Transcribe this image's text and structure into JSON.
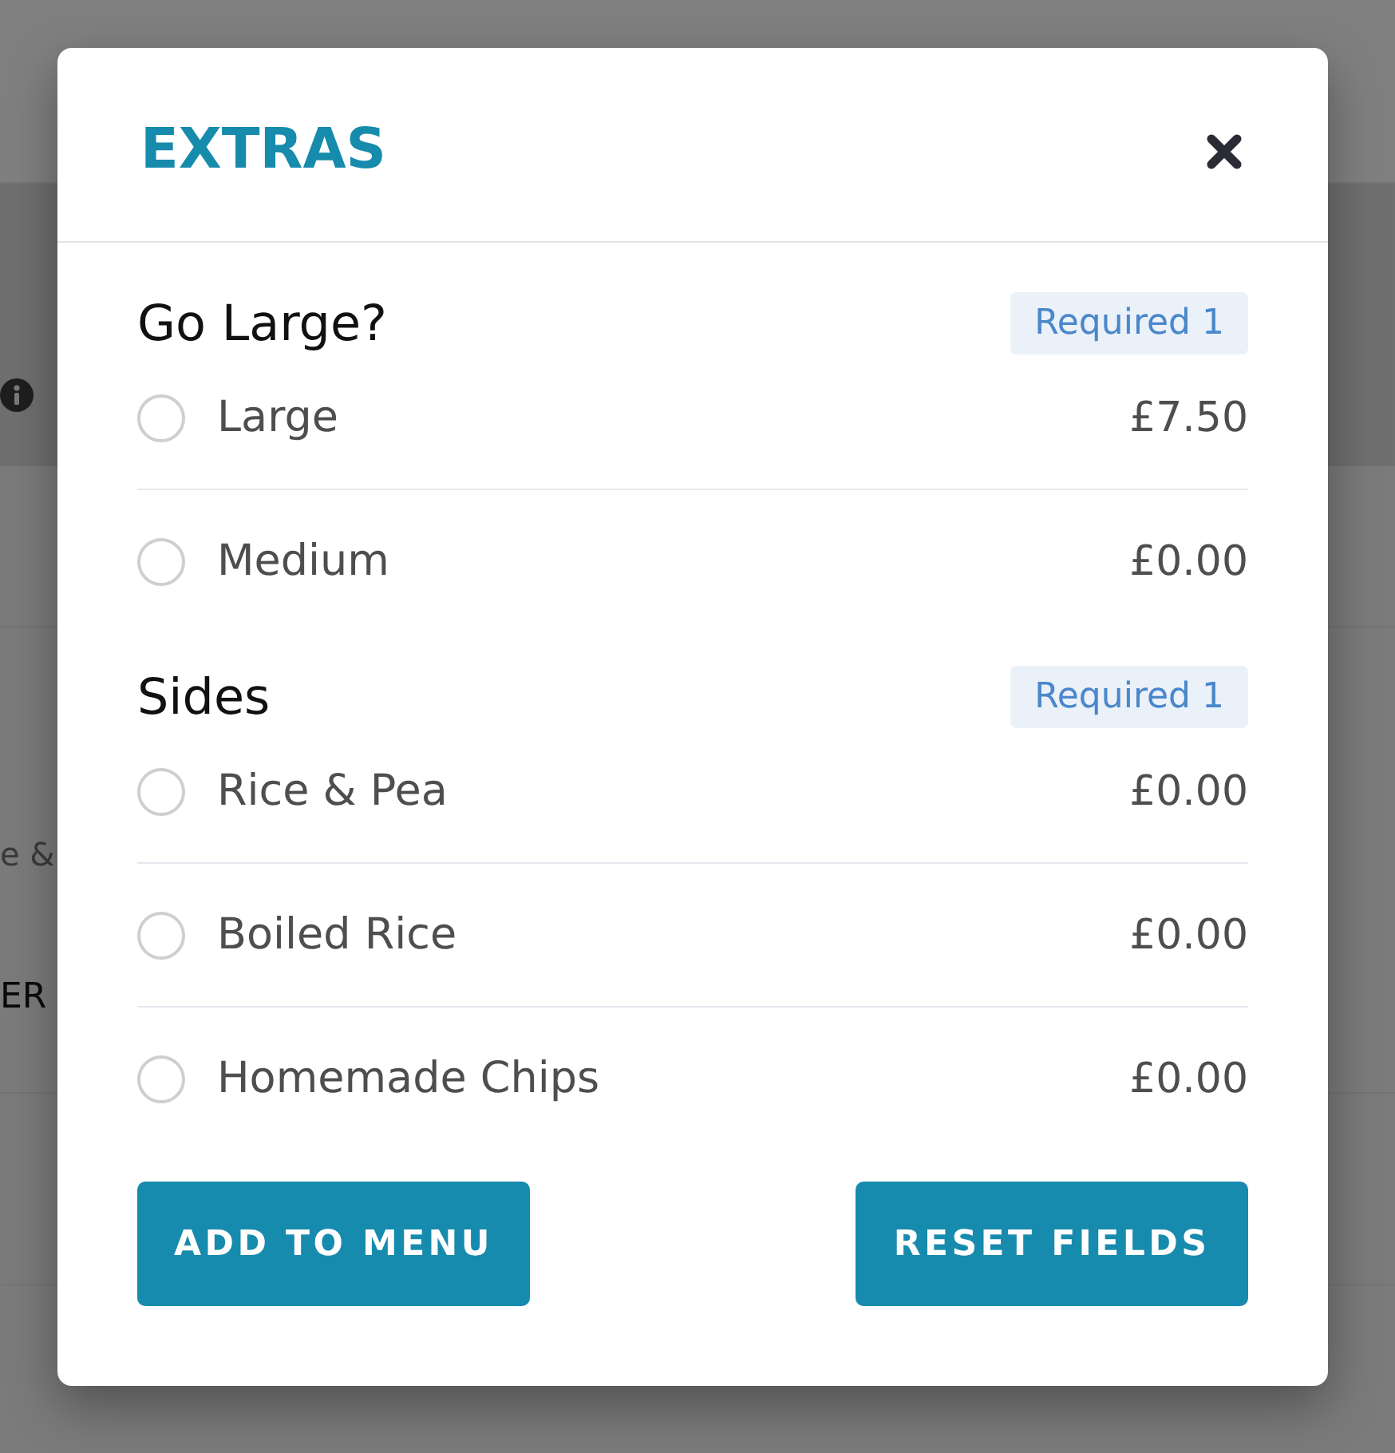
{
  "background_page": {
    "fragments": [
      {
        "kind": "muted",
        "text": "e &"
      },
      {
        "kind": "plain",
        "text": "ER"
      }
    ]
  },
  "modal": {
    "title": "EXTRAS",
    "groups": [
      {
        "title": "Go Large?",
        "badge": "Required 1",
        "options": [
          {
            "label": "Large",
            "price": "£7.50",
            "selected": false
          },
          {
            "label": "Medium",
            "price": "£0.00",
            "selected": false
          }
        ]
      },
      {
        "title": "Sides",
        "badge": "Required 1",
        "options": [
          {
            "label": "Rice & Pea",
            "price": "£0.00",
            "selected": false
          },
          {
            "label": "Boiled Rice",
            "price": "£0.00",
            "selected": false
          },
          {
            "label": "Homemade Chips",
            "price": "£0.00",
            "selected": false
          }
        ]
      }
    ],
    "buttons": [
      "ADD TO MENU",
      "RESET FIELDS"
    ]
  }
}
